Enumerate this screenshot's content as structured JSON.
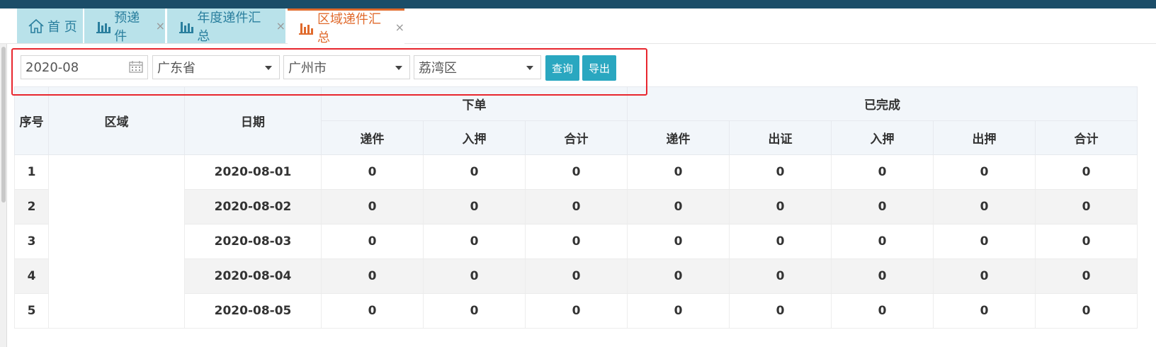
{
  "tabs": [
    {
      "label": "首 页",
      "icon": "home-icon",
      "closable": false,
      "active": false
    },
    {
      "label": "预递件",
      "icon": "bar-chart-icon",
      "closable": true,
      "active": false
    },
    {
      "label": "年度递件汇总",
      "icon": "bar-chart-icon",
      "closable": true,
      "active": false
    },
    {
      "label": "区域递件汇总",
      "icon": "bar-chart-icon",
      "closable": true,
      "active": true
    }
  ],
  "close_glyph": "×",
  "filters": {
    "month": "2020-08",
    "province": "广东省",
    "city": "广州市",
    "district": "荔湾区"
  },
  "buttons": {
    "query": "查询",
    "export": "导出"
  },
  "table": {
    "headers": {
      "index": "序号",
      "region": "区域",
      "date": "日期",
      "group_order": "下单",
      "group_done": "已完成",
      "order_cols": [
        "递件",
        "入押",
        "合计"
      ],
      "done_cols": [
        "递件",
        "出证",
        "入押",
        "出押",
        "合计"
      ]
    },
    "rows": [
      {
        "index": "1",
        "region": "",
        "date": "2020-08-01",
        "values": [
          "0",
          "0",
          "0",
          "0",
          "0",
          "0",
          "0",
          "0"
        ]
      },
      {
        "index": "2",
        "region": "",
        "date": "2020-08-02",
        "values": [
          "0",
          "0",
          "0",
          "0",
          "0",
          "0",
          "0",
          "0"
        ]
      },
      {
        "index": "3",
        "region": "",
        "date": "2020-08-03",
        "values": [
          "0",
          "0",
          "0",
          "0",
          "0",
          "0",
          "0",
          "0"
        ]
      },
      {
        "index": "4",
        "region": "",
        "date": "2020-08-04",
        "values": [
          "0",
          "0",
          "0",
          "0",
          "0",
          "0",
          "0",
          "0"
        ]
      },
      {
        "index": "5",
        "region": "",
        "date": "2020-08-05",
        "values": [
          "0",
          "0",
          "0",
          "0",
          "0",
          "0",
          "0",
          "0"
        ]
      }
    ]
  },
  "colors": {
    "accent": "#2aa7c0",
    "active_tab": "#e06a2c",
    "highlight": "#e8262e",
    "topbar": "#1b4d68"
  }
}
